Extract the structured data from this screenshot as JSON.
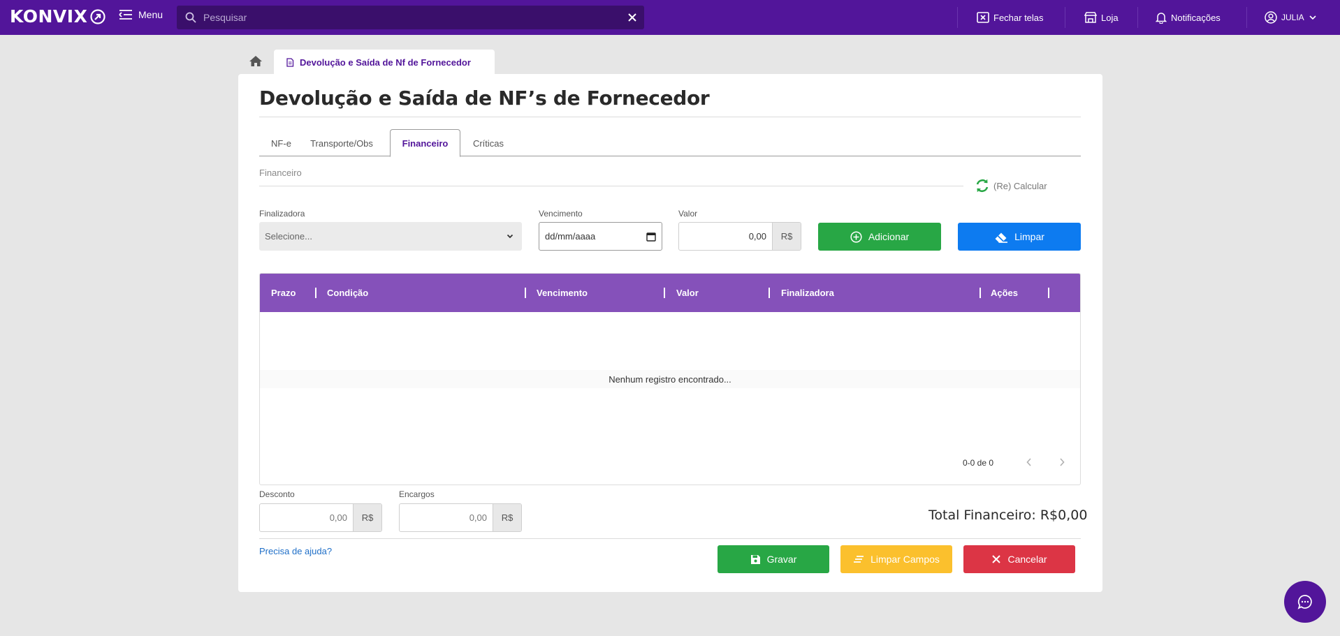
{
  "topbar": {
    "logo_text": "KONVIX",
    "menu_label": "Menu",
    "search_placeholder": "Pesquisar",
    "close_screens_label": "Fechar telas",
    "store_label": "Loja",
    "notifications_label": "Notificações",
    "user_label": "JULIA"
  },
  "breadcrumb": {
    "tab_label": "Devolução e Saída de Nf de Fornecedor"
  },
  "page": {
    "title": "Devolução e Saída de NF’s de Fornecedor",
    "tabs": [
      "NF-e",
      "Transporte/Obs",
      "Financeiro",
      "Críticas"
    ],
    "active_tab": "Financeiro"
  },
  "financeiro": {
    "section_label": "Financeiro",
    "recalc_label": "(Re) Calcular",
    "finalizadora_label": "Finalizadora",
    "finalizadora_value": "Selecione...",
    "vencimento_label": "Vencimento",
    "vencimento_value": "dd/mm/aaaa",
    "valor_label": "Valor",
    "valor_value": "0,00",
    "currency": "R$",
    "add_label": "Adicionar",
    "clear_label": "Limpar"
  },
  "table": {
    "columns": [
      "Prazo",
      "Condição",
      "Vencimento",
      "Valor",
      "Finalizadora",
      "Ações"
    ],
    "empty_message": "Nenhum registro encontrado...",
    "pagination": "0-0 de 0"
  },
  "totals": {
    "desconto_label": "Desconto",
    "desconto_value": "0,00",
    "encargos_label": "Encargos",
    "encargos_value": "0,00",
    "total_label": "Total Financeiro: R$0,00"
  },
  "footer": {
    "help_link": "Precisa de ajuda?",
    "save_label": "Gravar",
    "clear_fields_label": "Limpar Campos",
    "cancel_label": "Cancelar"
  },
  "colors": {
    "brand": "#52159a",
    "table_header": "#8551ba",
    "success": "#28a745",
    "primary": "#0d7bf0",
    "warning": "#fbc02d",
    "danger": "#dc3545"
  }
}
